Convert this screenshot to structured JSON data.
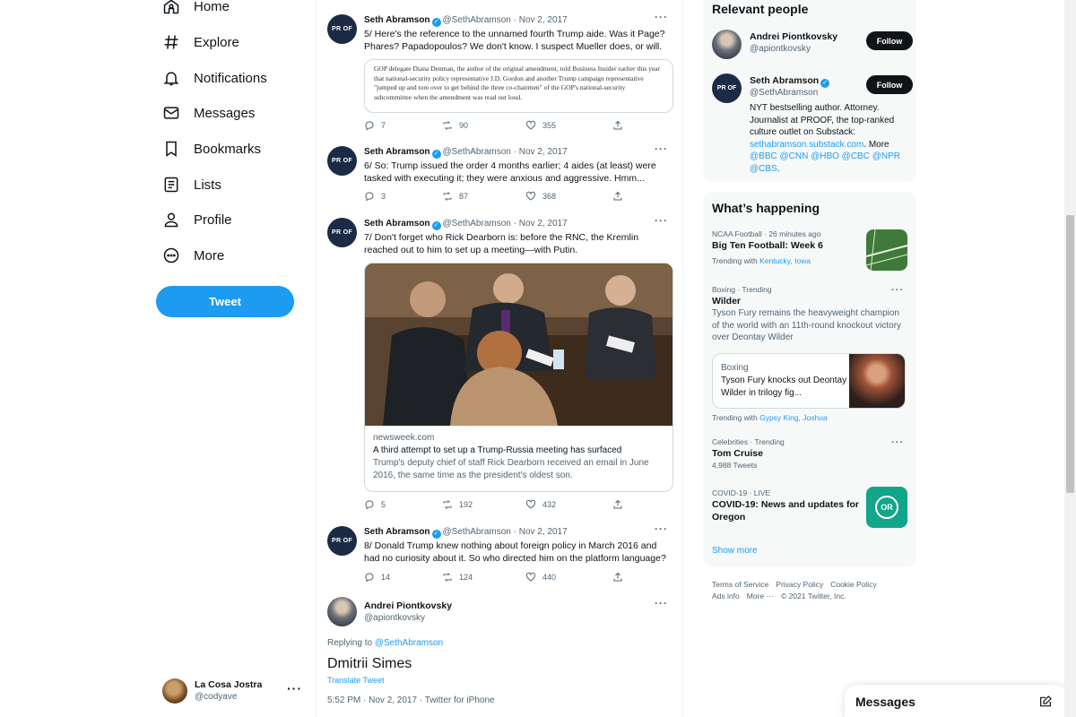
{
  "nav": {
    "items": [
      {
        "label": "Home",
        "icon": "home-icon"
      },
      {
        "label": "Explore",
        "icon": "hashtag-icon"
      },
      {
        "label": "Notifications",
        "icon": "bell-icon"
      },
      {
        "label": "Messages",
        "icon": "envelope-icon"
      },
      {
        "label": "Bookmarks",
        "icon": "bookmark-icon"
      },
      {
        "label": "Lists",
        "icon": "list-icon"
      },
      {
        "label": "Profile",
        "icon": "person-icon"
      },
      {
        "label": "More",
        "icon": "more-circle-icon"
      }
    ],
    "tweet_button": "Tweet"
  },
  "account": {
    "name": "La Cosa Jostra",
    "handle": "@codyave",
    "menu": "···"
  },
  "tweets": [
    {
      "avatar_text": "PR OF",
      "name": "Seth Abramson",
      "handle": "@SethAbramson",
      "date": "· Nov 2, 2017",
      "text": "5/ Here's the reference to the unnamed fourth Trump aide. Was it Page? Phares? Papadopoulos? We don't know. I suspect Mueller does, or will.",
      "quote_image_text": "GOP delegate Diana Denman, the author of the original amendment, told Business Insider earlier this year that national-security policy representative J.D. Gordon and another Trump campaign representative \"jumped up and tore over to get behind the three co-chairmen\" of the GOP's national-security subcommittee when the amendment was read out loud.",
      "replies": "7",
      "retweets": "90",
      "likes": "355"
    },
    {
      "avatar_text": "PR OF",
      "name": "Seth Abramson",
      "handle": "@SethAbramson",
      "date": "· Nov 2, 2017",
      "text": "6/ So: Trump issued the order 4 months earlier; 4 aides (at least) were tasked with executing it; they were anxious and aggressive. Hmm...",
      "replies": "3",
      "retweets": "87",
      "likes": "368"
    },
    {
      "avatar_text": "PR OF",
      "name": "Seth Abramson",
      "handle": "@SethAbramson",
      "date": "· Nov 2, 2017",
      "text": "7/ Don't forget who Rick Dearborn is: before the RNC, the Kremlin reached out to him to set up a meeting—with Putin.",
      "card": {
        "domain": "newsweek.com",
        "title": "A third attempt to set up a Trump-Russia meeting has surfaced",
        "description": "Trump's deputy chief of staff Rick Dearborn received an email in June 2016, the same time as the president's oldest son."
      },
      "replies": "5",
      "retweets": "192",
      "likes": "432"
    },
    {
      "avatar_text": "PR OF",
      "name": "Seth Abramson",
      "handle": "@SethAbramson",
      "date": "· Nov 2, 2017",
      "text": "8/ Donald Trump knew nothing about foreign policy in March 2016 and had no curiosity about it. So who directed him on the platform language?",
      "replies": "14",
      "retweets": "124",
      "likes": "440"
    }
  ],
  "reply": {
    "name": "Andrei Piontkovsky",
    "handle": "@apiontkovsky",
    "replying_prefix": "Replying to ",
    "replying_to": "@SethAbramson",
    "text": "Dmitrii Simes",
    "translate": "Translate Tweet",
    "timestamp": "5:52 PM · Nov 2, 2017 · Twitter for iPhone"
  },
  "relevant": {
    "title": "Relevant people",
    "people": [
      {
        "name": "Andrei Piontkovsky",
        "handle": "@apiontkovsky",
        "button": "Follow"
      },
      {
        "name": "Seth Abramson",
        "handle": "@SethAbramson",
        "button": "Follow",
        "bio_text": "NYT bestselling author. Attorney. Journalist at PROOF, the top-ranked culture outlet on Substack: ",
        "bio_link": "sethabramson.substack.com",
        "bio_more": ". More ",
        "bio_mentions": "@BBC @CNN @HBO @CBC @NPR @CBS",
        "bio_end": "."
      }
    ]
  },
  "happening": {
    "title": "What’s happening",
    "trends": [
      {
        "category": "NCAA Football · 26 minutes ago",
        "title": "Big Ten Football: Week 6",
        "trending_prefix": "Trending with ",
        "trending_with": "Kentucky, Iowa"
      },
      {
        "category": "Boxing · Trending",
        "title": "Wilder",
        "description": "Tyson Fury remains the heavyweight champion of the world with an 11th-round knockout victory over Deontay Wilder",
        "card": {
          "category": "Boxing",
          "text": "Tyson Fury knocks out Deontay Wilder in trilogy fig..."
        },
        "trending_prefix": "Trending with ",
        "trending_with": "Gypsy King, Joshua"
      },
      {
        "category": "Celebrities · Trending",
        "title": "Tom Cruise",
        "count": "4,988 Tweets"
      },
      {
        "category": "COVID-19 · LIVE",
        "title": "COVID-19: News and updates for Oregon",
        "badge": "OR"
      }
    ],
    "show_more": "Show more"
  },
  "footer": {
    "links": [
      "Terms of Service",
      "Privacy Policy",
      "Cookie Policy",
      "Ads info",
      "More ···"
    ],
    "copyright": "© 2021 Twitter, Inc."
  },
  "messages_drawer": {
    "title": "Messages"
  },
  "colors": {
    "accent": "#1d9bf0",
    "text": "#0f1419",
    "muted": "#536471",
    "panel": "#f7f9f9"
  }
}
